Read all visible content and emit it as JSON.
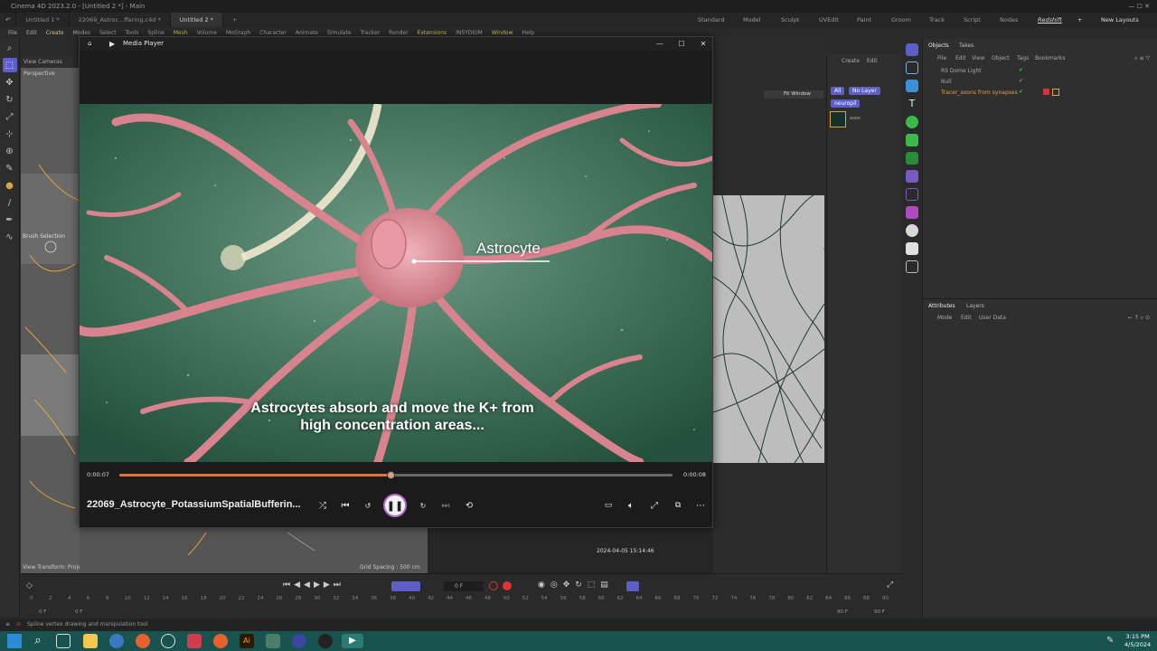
{
  "app": {
    "title": "Cinema 4D 2023.2.0 - [Untitled 2 *] - Main",
    "tabs": [
      "Untitled 1 *",
      "22069_Astroc...ffering.c4d *",
      "Untitled 2 *"
    ],
    "layouts": [
      "Standard",
      "Model",
      "Sculpt",
      "UVEdit",
      "Paint",
      "Groom",
      "Track",
      "Script",
      "Nodes",
      "Redshift"
    ],
    "new_layouts": "New Layouts",
    "menu": [
      "File",
      "Edit",
      "Create",
      "Modes",
      "Select",
      "Tools",
      "Spline",
      "Mesh",
      "Volume",
      "MoGraph",
      "Character",
      "Animate",
      "Simulate",
      "Tracker",
      "Render",
      "Extensions",
      "INSYDIUM",
      "Window",
      "Help"
    ]
  },
  "viewport": {
    "view_label": "View",
    "cameras_label": "Cameras",
    "perspective": "Perspective",
    "brush_selection": "Brush Selection",
    "view_transform": "View Transform: Project",
    "grid_spacing": "Grid Spacing : 500 cm",
    "timestamp": "2024-04-05  15:14:46"
  },
  "player": {
    "window_title": "Media Player",
    "label_astrocyte": "Astrocyte",
    "subtitle_line1": "Astrocytes absorb and move the K+ from",
    "subtitle_line2": "high concentration areas...",
    "time_current": "0:00:07",
    "time_total": "0:00:08",
    "progress": 0.49,
    "filename": "22069_Astrocyte_PotassiumSpatialBufferin..."
  },
  "layers_panel": {
    "create": "Create",
    "edit": "Edit",
    "all_label": "All",
    "no_layer": "No Layer",
    "fit_window": "Fit Window",
    "neuropil": "neuropil",
    "axon": "axon"
  },
  "objects": {
    "tab_objects": "Objects",
    "tab_takes": "Takes",
    "menu": [
      "File",
      "Edit",
      "View",
      "Object",
      "Tags",
      "Bookmarks"
    ],
    "items": [
      "RS Dome Light",
      "Null",
      "Tracer_axons from synapses"
    ]
  },
  "attributes": {
    "tab_attributes": "Attributes",
    "tab_layers": "Layers",
    "mode": "Mode",
    "edit": "Edit",
    "user_data": "User Data"
  },
  "timeline": {
    "frame_field": "0 F",
    "start": "0 F",
    "start2": "0 F",
    "end": "90 F",
    "end2": "90 F",
    "ticks": [
      "0",
      "2",
      "4",
      "6",
      "8",
      "10",
      "12",
      "14",
      "16",
      "18",
      "20",
      "22",
      "24",
      "26",
      "28",
      "30",
      "32",
      "34",
      "36",
      "38",
      "40",
      "42",
      "44",
      "46",
      "48",
      "50",
      "52",
      "54",
      "56",
      "58",
      "60",
      "62",
      "64",
      "66",
      "68",
      "70",
      "72",
      "74",
      "76",
      "78",
      "80",
      "82",
      "84",
      "86",
      "88",
      "90"
    ]
  },
  "status": {
    "text": "Spline vertex drawing and manipulation tool"
  },
  "taskbar": {
    "time": "3:15 PM",
    "date": "4/5/2024"
  },
  "colors": {
    "accent_purple": "#5b5fc7",
    "progress_orange": "#e0733a",
    "taskbar_teal": "#18534f"
  }
}
